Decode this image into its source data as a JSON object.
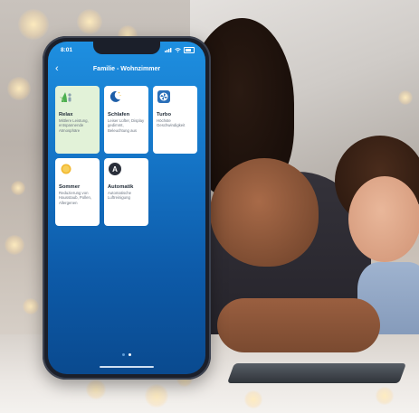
{
  "status": {
    "time": "8:01"
  },
  "nav": {
    "back_glyph": "‹",
    "title": "Familie - Wohnzimmer"
  },
  "scenes": [
    {
      "name": "Relax",
      "description": "Mittlere Leistung, entspannende Atmosphäre",
      "icon": "relax-icon",
      "active": true
    },
    {
      "name": "Schlafen",
      "description": "Leiser Lüfter, Display gedimmt, Beleuchtung aus",
      "icon": "moon-icon",
      "active": false
    },
    {
      "name": "Turbo",
      "description": "Höchste Geschwindigkeit",
      "icon": "fan-icon",
      "active": false
    },
    {
      "name": "Sommer",
      "description": "Reduzierung von Hausstaub, Pollen, Allergenen",
      "icon": "sun-icon",
      "active": false
    },
    {
      "name": "Automatik",
      "description": "Automatische Luftreinigung",
      "icon": "auto-icon",
      "active": false
    }
  ],
  "auto_icon_letter": "A",
  "pager": {
    "pages": 2,
    "current": 2
  },
  "colors": {
    "accent": "#1575c7",
    "active_card": "#e2f2d8"
  }
}
